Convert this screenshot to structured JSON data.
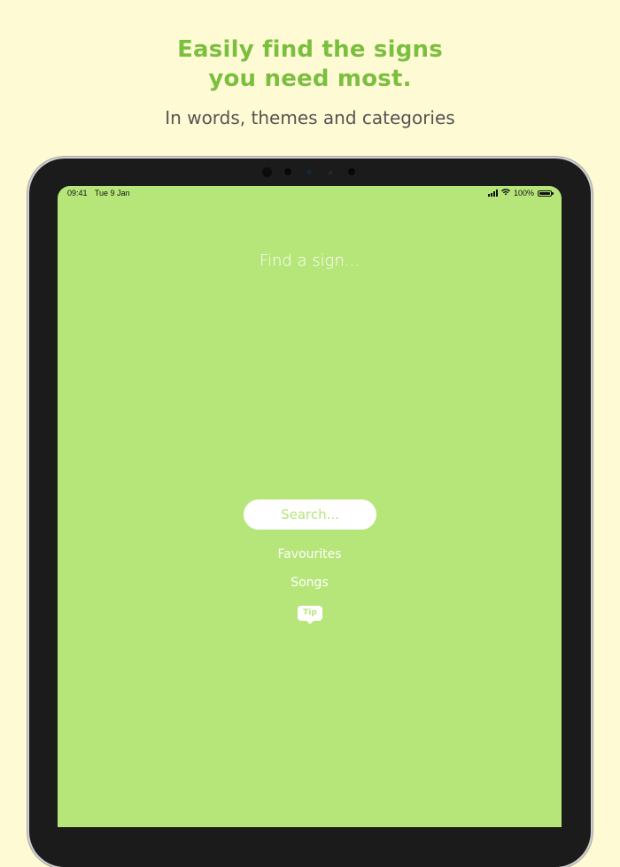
{
  "header": {
    "headline_line1": "Easily find the signs",
    "headline_line2": "you need most.",
    "subline": "In words, themes and categories"
  },
  "status_bar": {
    "time": "09:41",
    "date": "Tue 9 Jan",
    "battery": "100%"
  },
  "app": {
    "find_title": "Find a sign...",
    "search_placeholder": "Search...",
    "favourites": "Favourites",
    "songs": "Songs",
    "tip": "Tip"
  },
  "colors": {
    "background": "#fefad4",
    "accent_green": "#7bbf3f",
    "screen_green": "#b6e67a"
  }
}
